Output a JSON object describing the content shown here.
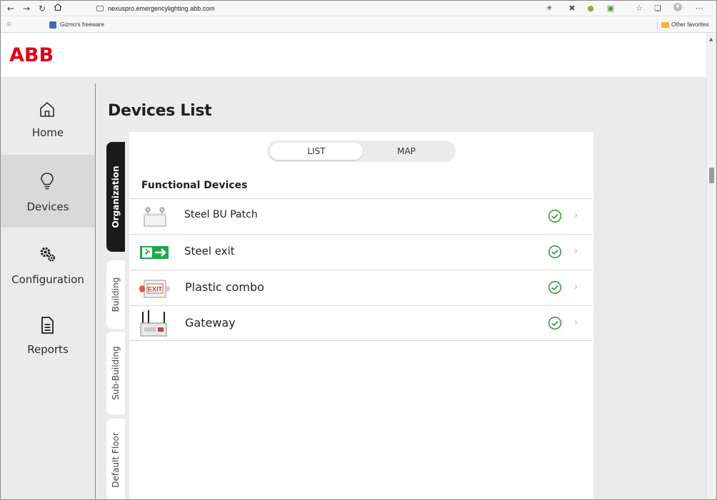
{
  "browser": {
    "url": "nexuspro.emergencylighting.abb.com",
    "favorites": [
      {
        "label": "Gizmo's freeware"
      }
    ],
    "other_favorites": "Other favorites",
    "icons": {
      "back": "back-icon",
      "forward": "forward-icon",
      "reload": "reload-icon",
      "home": "home-icon"
    }
  },
  "brand": {
    "logo": "ABB",
    "color": "#e2001a"
  },
  "sidebar": {
    "items": [
      {
        "label": "Home",
        "icon": "home-icon"
      },
      {
        "label": "Devices",
        "icon": "lightbulb-icon",
        "active": true
      },
      {
        "label": "Configuration",
        "icon": "gear-icon"
      },
      {
        "label": "Reports",
        "icon": "document-icon"
      }
    ]
  },
  "page": {
    "title": "Devices List",
    "tabs": {
      "list": "LIST",
      "map": "MAP",
      "selected": "LIST"
    },
    "vertical_tabs": [
      {
        "label": "Organization",
        "active": true
      },
      {
        "label": "Building"
      },
      {
        "label": "Sub-Building"
      },
      {
        "label": "Default Floor"
      }
    ],
    "section_title": "Functional Devices",
    "devices": [
      {
        "name": "Steel BU Patch",
        "status": "ok",
        "icon": "emergency-light-icon"
      },
      {
        "name": "Steel exit",
        "status": "ok",
        "icon": "exit-sign-icon"
      },
      {
        "name": "Plastic combo",
        "status": "ok",
        "icon": "exit-combo-icon"
      },
      {
        "name": "Gateway",
        "status": "ok",
        "icon": "gateway-icon"
      }
    ]
  },
  "colors": {
    "accent_green": "#3c9a3c",
    "active_tab": "#1a1a1a"
  }
}
